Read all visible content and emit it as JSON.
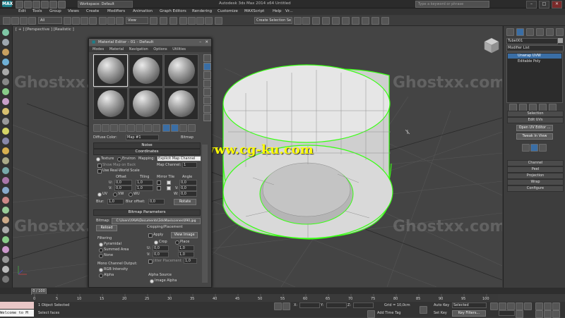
{
  "titlebar": {
    "app_logo": "MAX",
    "workspace": "Workspace: Default",
    "title": "Autodesk 3ds Max 2014 x64    Untitled",
    "search_placeholder": "Type a keyword or phrase",
    "min": "–",
    "max": "□",
    "close": "✕"
  },
  "menubar": {
    "items": [
      "Edit",
      "Tools",
      "Group",
      "Views",
      "Create",
      "Modifiers",
      "Animation",
      "Graph Editors",
      "Rendering",
      "Customize",
      "MAXScript",
      "Help",
      "Vr..."
    ]
  },
  "toolbar": {
    "selection_filter": "All",
    "ref_coord": "View",
    "named_set": "Create Selection Se"
  },
  "viewport": {
    "label": "[ + ] [Perspective ] [Realistic ]",
    "watermark": "Ghostxx.com",
    "url_overlay": "www.cg-ku.com"
  },
  "material_editor": {
    "title": "Material Editor - 01 - Default",
    "menu": [
      "Modes",
      "Material",
      "Navigation",
      "Options",
      "Utilities"
    ],
    "diffuse_label": "Diffuse Color:",
    "map_name": "Map #1",
    "map_type": "Bitmap",
    "noise_roll": "Noise",
    "coordinates_roll": "Coordinates",
    "texture_label": "Texture",
    "environ_label": "Environ",
    "mapping_label": "Mapping:",
    "mapping_value": "Explicit Map Channel",
    "show_map_label": "Show Map on Back",
    "map_channel_label": "Map Channel:",
    "map_channel_value": "1",
    "real_world_label": "Use Real-World Scale",
    "offset_label": "Offset",
    "tiling_label": "Tiling",
    "mirror_tile_label": "Mirror Tile",
    "angle_label": "Angle",
    "u_label": "U:",
    "v_label": "V:",
    "w_label": "W:",
    "u_offset": "0,0",
    "v_offset": "0,0",
    "u_tiling": "1,0",
    "v_tiling": "1,0",
    "u_angle": "0,0",
    "v_angle": "0,0",
    "w_angle": "0,0",
    "uv_label": "UV",
    "vw_label": "VW",
    "wu_label": "WU",
    "blur_label": "Blur:",
    "blur_value": "1,0",
    "blur_offset_label": "Blur offset:",
    "blur_offset_value": "0,0",
    "rotate_label": "Rotate",
    "bitmap_roll": "Bitmap Parameters",
    "bitmap_label": "Bitmap:",
    "bitmap_path": "C:\\Users\\YAVA\\Documents\\3dsMax\\scenes\\090.jpg",
    "reload_label": "Reload",
    "cropping_label": "Cropping/Placement",
    "apply_label": "Apply",
    "view_image_label": "View Image",
    "crop_label": "Crop",
    "place_label": "Place",
    "filtering_label": "Filtering",
    "pyramidal_label": "Pyramidal",
    "summed_area_label": "Summed Area",
    "none_label": "None",
    "crop_u": "0,0",
    "crop_v": "0,0",
    "crop_w": "1,0",
    "crop_h": "1,0",
    "jitter_label": "Jitter Placement",
    "jitter_value": "1,0",
    "mono_output_label": "Mono Channel Output:",
    "rgb_intensity_label": "RGB Intensity",
    "alpha_label": "Alpha",
    "alpha_source_label": "Alpha Source",
    "image_alpha_label": "Image Alpha"
  },
  "command_panel": {
    "object_name": "Tube001",
    "modifier_list": "Modifier List",
    "stack": [
      "Unwrap UVW",
      "Editable Poly"
    ],
    "rollouts": [
      "Selection",
      "Edit UVs",
      "Channel",
      "Peel",
      "Projection",
      "Wrap",
      "Configure"
    ],
    "open_uv_editor": "Open UV Editor ...",
    "tweak_in_view": "Tweak In View"
  },
  "timeline": {
    "frame_label": "0 / 100",
    "ticks": [
      "0",
      "5",
      "10",
      "15",
      "20",
      "25",
      "30",
      "35",
      "40",
      "45",
      "50",
      "55",
      "60",
      "65",
      "70",
      "75",
      "80",
      "85",
      "90",
      "95",
      "100"
    ]
  },
  "status": {
    "maxscript": "Welcome to M",
    "selected": "1 Object Selected",
    "prompt": "Select faces",
    "grid": "Grid = 10,0cm",
    "add_time_tag": "Add Time Tag",
    "auto_key": "Auto Key",
    "set_key": "Set Key",
    "selected_dd": "Selected",
    "key_filters": "Key Filters...",
    "x_label": "X:",
    "y_label": "Y:",
    "z_label": "Z:"
  },
  "colors": {
    "accent_teal": "#1c7f8a",
    "selection_green": "#39ff14",
    "url_yellow": "#ffff00"
  }
}
